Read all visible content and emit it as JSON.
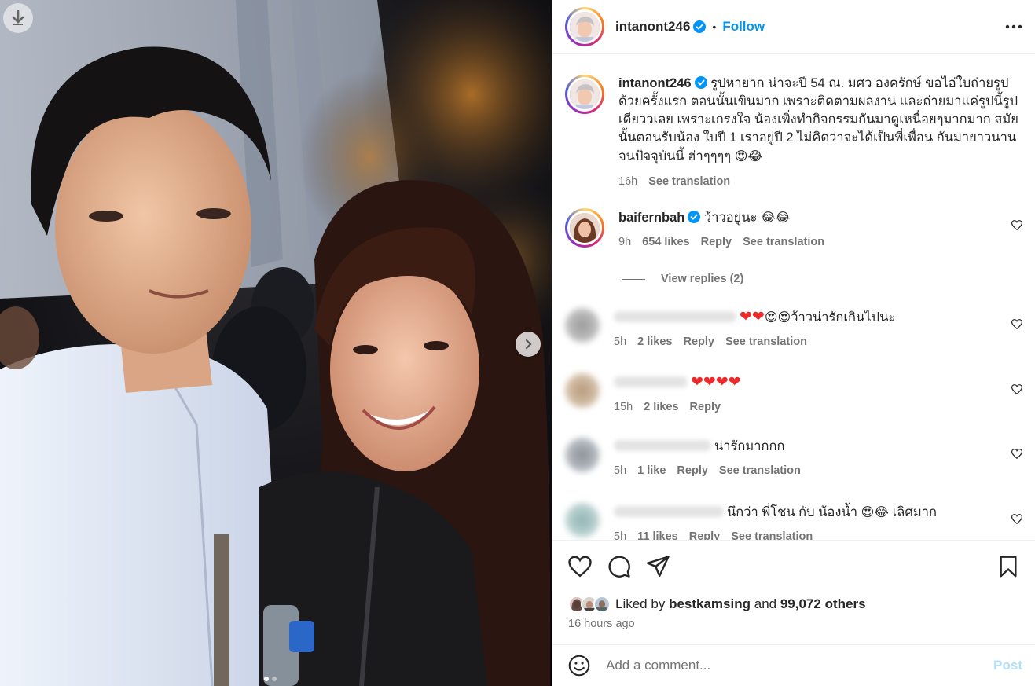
{
  "post_author": {
    "username": "intanont246",
    "follow_label": "Follow",
    "separator": "•"
  },
  "caption": {
    "username": "intanont246",
    "text": "รูปหายาก น่าจะปี 54 ณ. มศว องครักษ์ ขอไอ่ใบถ่ายรูปด้วยครั้งแรก ตอนนั้นเขินมาก เพราะติดตามผลงาน และถ่ายมาแค่รูปนี้รูปเดียววเลย เพราะเกรงใจ น้องเพิ่งทำกิจกรรมกันมาดูเหนื่อยๆมากมาก สมัยนั้นตอนรับน้อง ใบปี 1 เราอยู่ปี 2 ไม่คิดว่าจะได้เป็นพี่เพื่อน กันมายาวนานจนปัจจุบันนี้ ฮ่าๆๆๆๆ",
    "emojis": "😍😂",
    "time": "16h",
    "see_translation": "See translation"
  },
  "comments": [
    {
      "username": "baifernbah",
      "text": "ว้าวอยู่นะ",
      "emojis": "😂😂",
      "time": "9h",
      "likes": "654 likes",
      "reply": "Reply",
      "see_translation": "See translation",
      "view_replies": "View replies (2)"
    },
    {
      "text": "ว้าวน่ารักเกินไปนะ",
      "emojis": "😍😍",
      "hearts": "❤❤",
      "time": "5h",
      "likes": "2 likes",
      "reply": "Reply",
      "see_translation": "See translation"
    },
    {
      "hearts": "❤❤❤❤",
      "time": "15h",
      "likes": "2 likes",
      "reply": "Reply"
    },
    {
      "text": "น่ารักมากกก",
      "time": "5h",
      "likes": "1 like",
      "reply": "Reply",
      "see_translation": "See translation"
    },
    {
      "text": "นึกว่า พี่โชน กับ น้องน้ำ",
      "emojis": "😍😂",
      "text_after": "เลิศมาก",
      "time": "5h",
      "likes": "11 likes",
      "reply": "Reply",
      "see_translation": "See translation"
    }
  ],
  "likes": {
    "prefix": "Liked by",
    "user": "bestkamsing",
    "and": "and",
    "others": "99,072 others"
  },
  "timestamp": "16 hours ago",
  "comment_box": {
    "placeholder": "Add a comment...",
    "post_label": "Post"
  },
  "carousel": {
    "total": 2,
    "current": 1
  },
  "colors": {
    "accent": "#0095f6",
    "post_disabled": "#b2dffc",
    "heart": "#ed2a2a",
    "verified": "#0095f6"
  },
  "icons": [
    "download-icon",
    "chevron-right-icon",
    "verified-icon",
    "more-icon",
    "heart-icon",
    "comment-icon",
    "share-icon",
    "bookmark-icon",
    "emoji-icon"
  ]
}
